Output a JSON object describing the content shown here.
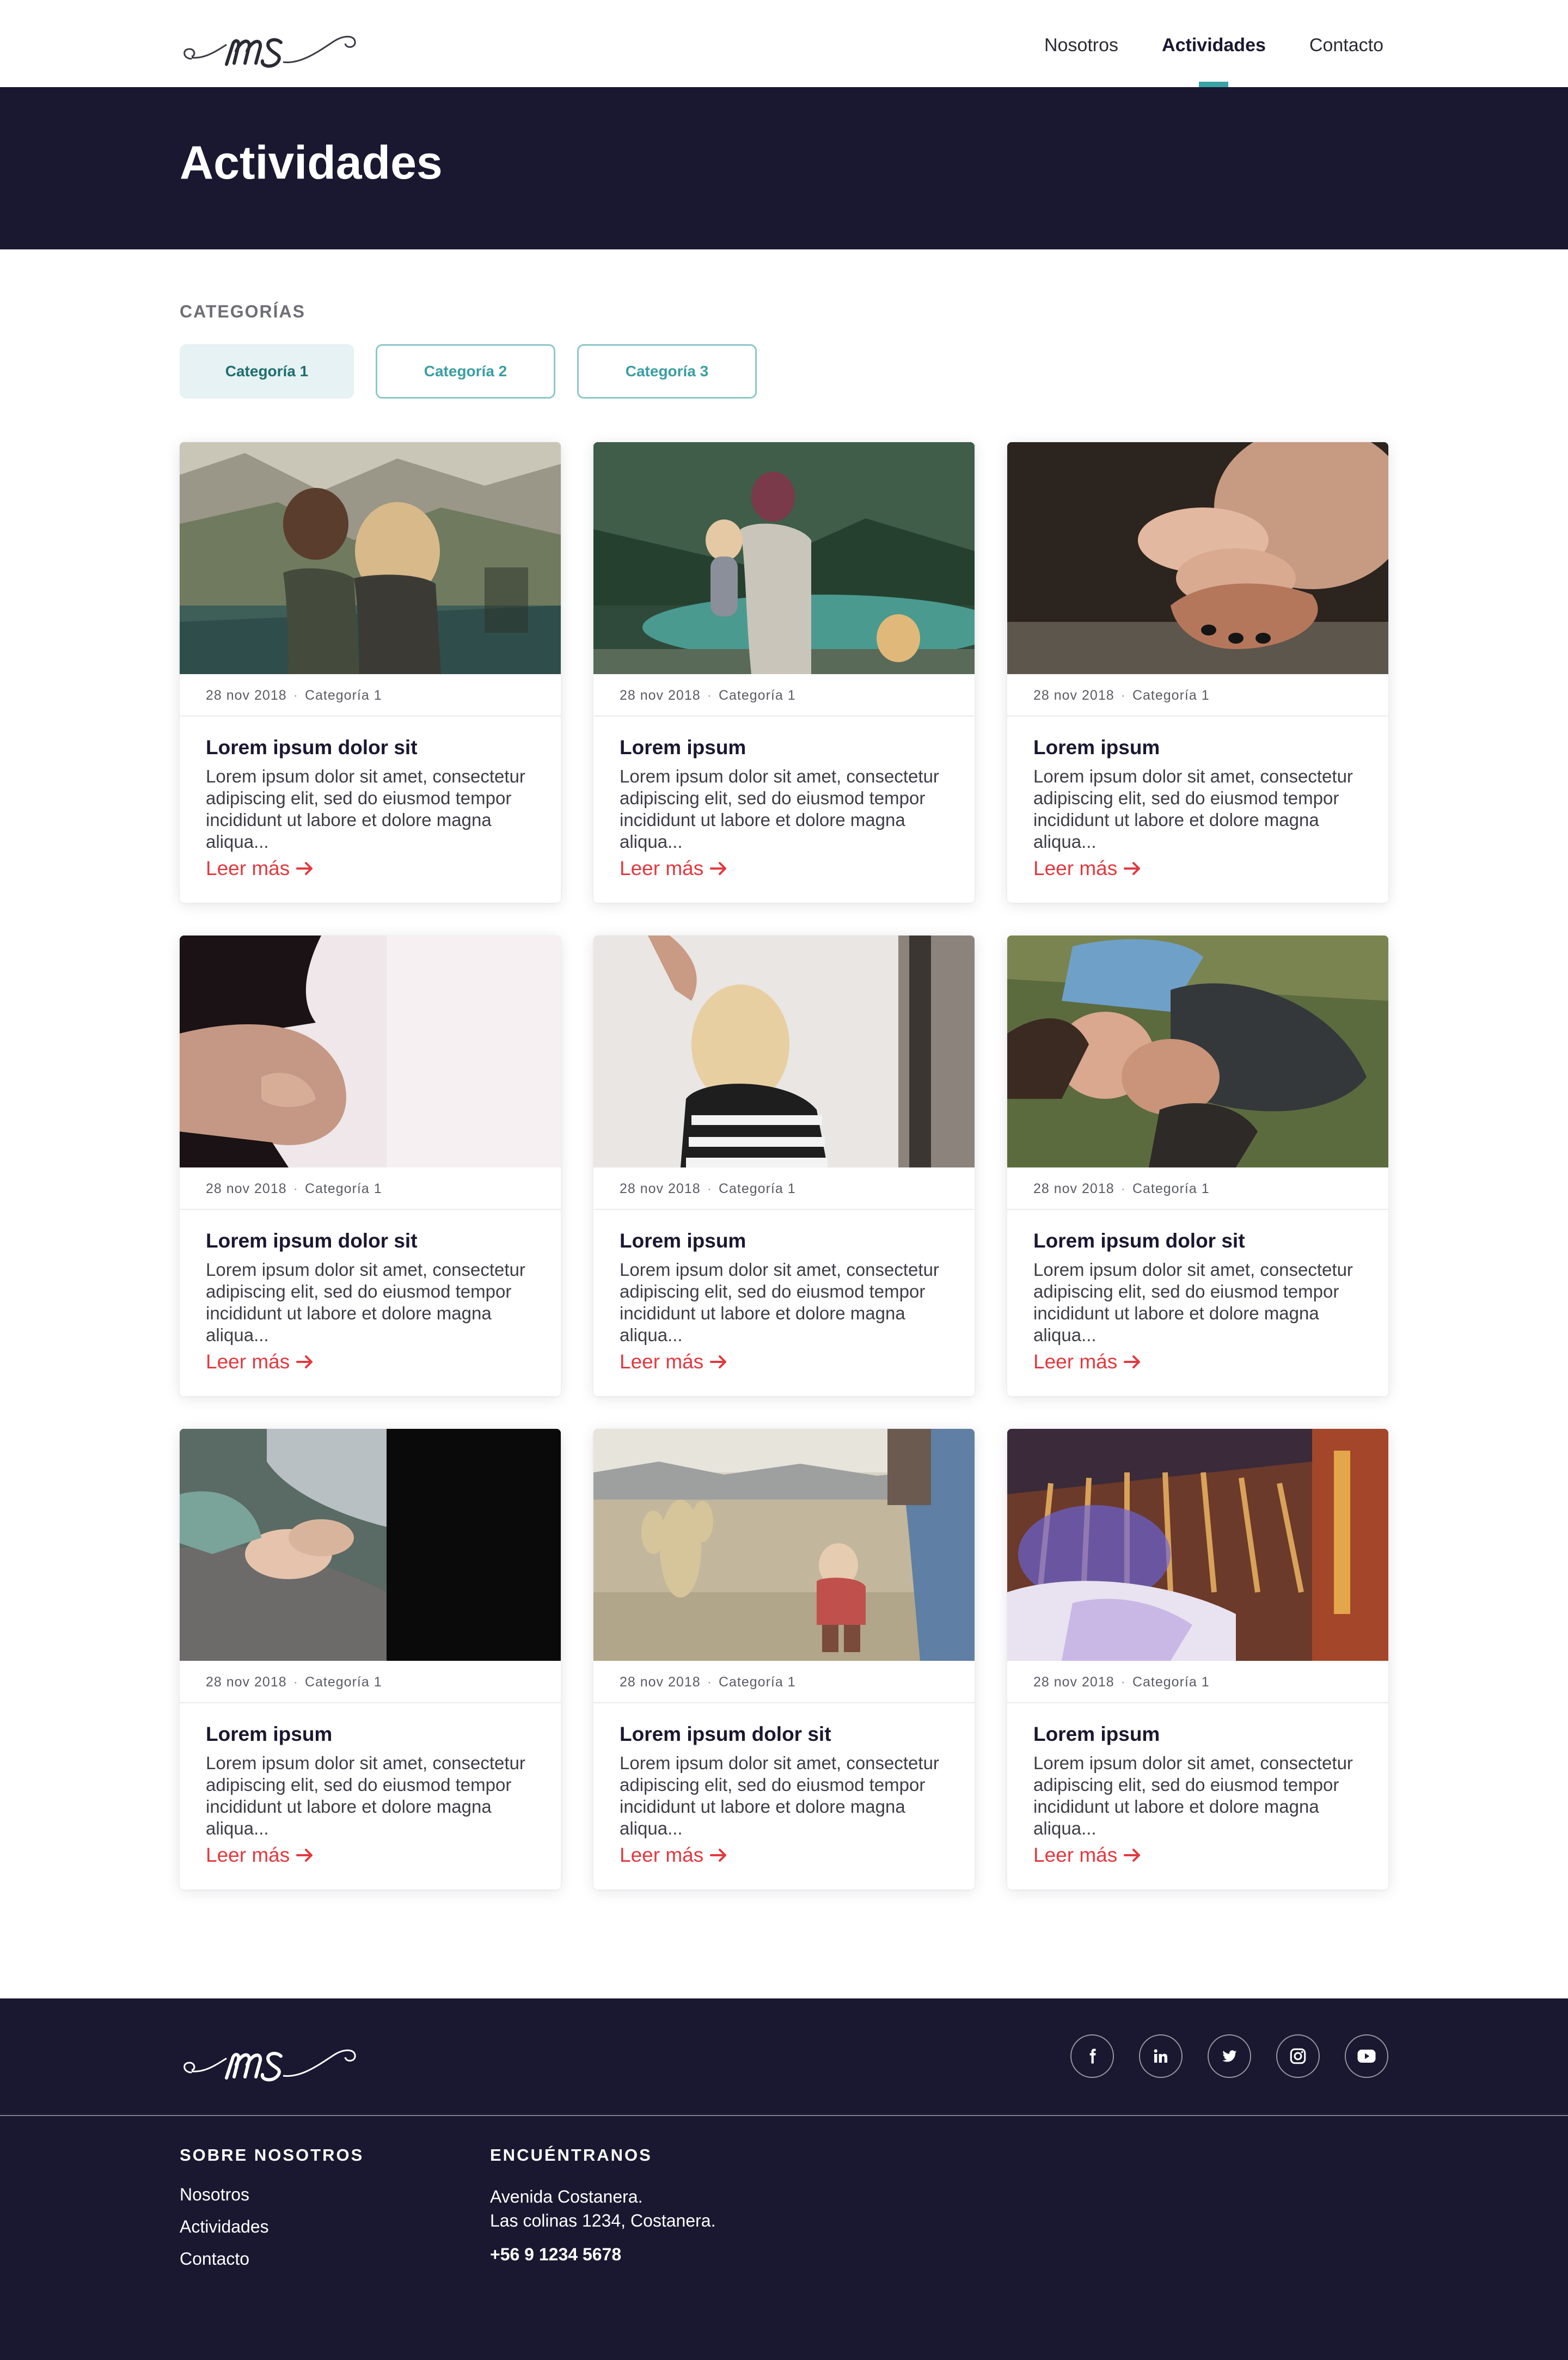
{
  "nav": {
    "items": [
      "Nosotros",
      "Actividades",
      "Contacto"
    ],
    "active": "Actividades"
  },
  "hero": {
    "title": "Actividades"
  },
  "categories": {
    "label": "CATEGORÍAS",
    "chips": [
      "Categoría 1",
      "Categoría 2",
      "Categoría 3"
    ],
    "selected": "Categoría 1"
  },
  "cards": [
    {
      "date": "28 nov 2018",
      "category": "Categoría 1",
      "title": "Lorem ipsum dolor sit",
      "excerpt": "Lorem ipsum dolor sit amet, consectetur adipiscing elit, sed do eiusmod tempor incididunt ut labore et dolore magna aliqua...",
      "more": "Leer más",
      "image": "two-women-lake-cliffs"
    },
    {
      "date": "28 nov 2018",
      "category": "Categoría 1",
      "title": "Lorem ipsum",
      "excerpt": "Lorem ipsum dolor sit amet, consectetur adipiscing elit, sed do eiusmod tempor incididunt ut labore et dolore magna aliqua...",
      "more": "Leer más",
      "image": "mother-child-mountain-lake"
    },
    {
      "date": "28 nov 2018",
      "category": "Categoría 1",
      "title": "Lorem ipsum",
      "excerpt": "Lorem ipsum dolor sit amet, consectetur adipiscing elit, sed do eiusmod tempor incididunt ut labore et dolore magna aliqua...",
      "more": "Leer más",
      "image": "baby-feet-in-hand"
    },
    {
      "date": "28 nov 2018",
      "category": "Categoría 1",
      "title": "Lorem ipsum dolor sit",
      "excerpt": "Lorem ipsum dolor sit amet, consectetur adipiscing elit, sed do eiusmod tempor incididunt ut labore et dolore magna aliqua...",
      "more": "Leer más",
      "image": "pregnant-belly"
    },
    {
      "date": "28 nov 2018",
      "category": "Categoría 1",
      "title": "Lorem ipsum",
      "excerpt": "Lorem ipsum dolor sit amet, consectetur adipiscing elit, sed do eiusmod tempor incididunt ut labore et dolore magna aliqua...",
      "more": "Leer más",
      "image": "girl-hair-braiding"
    },
    {
      "date": "28 nov 2018",
      "category": "Categoría 1",
      "title": "Lorem ipsum dolor sit",
      "excerpt": "Lorem ipsum dolor sit amet, consectetur adipiscing elit, sed do eiusmod tempor incididunt ut labore et dolore magna aliqua...",
      "more": "Leer más",
      "image": "mother-daughter-grass"
    },
    {
      "date": "28 nov 2018",
      "category": "Categoría 1",
      "title": "Lorem ipsum",
      "excerpt": "Lorem ipsum dolor sit amet, consectetur adipiscing elit, sed do eiusmod tempor incididunt ut labore et dolore magna aliqua...",
      "more": "Leer más",
      "image": "holding-hands"
    },
    {
      "date": "28 nov 2018",
      "category": "Categoría 1",
      "title": "Lorem ipsum dolor sit",
      "excerpt": "Lorem ipsum dolor sit amet, consectetur adipiscing elit, sed do eiusmod tempor incididunt ut labore et dolore magna aliqua...",
      "more": "Leer más",
      "image": "desert-walk-child"
    },
    {
      "date": "28 nov 2018",
      "category": "Categoría 1",
      "title": "Lorem ipsum",
      "excerpt": "Lorem ipsum dolor sit amet, consectetur adipiscing elit, sed do eiusmod tempor incididunt ut labore et dolore magna aliqua...",
      "more": "Leer más",
      "image": "clothes-hangers"
    }
  ],
  "footer": {
    "social": [
      "facebook-icon",
      "linkedin-icon",
      "twitter-icon",
      "instagram-icon",
      "youtube-icon"
    ],
    "about_heading": "SOBRE NOSOTROS",
    "about_links": [
      "Nosotros",
      "Actividades",
      "Contacto"
    ],
    "find_heading": "ENCUÉNTRANOS",
    "address_line1": "Avenida Costanera.",
    "address_line2": "Las colinas 1234, Costanera.",
    "phone": "+56 9 1234 5678"
  },
  "colors": {
    "navy": "#1a1730",
    "teal": "#3aa3a6",
    "accent_red": "#e2393f"
  }
}
